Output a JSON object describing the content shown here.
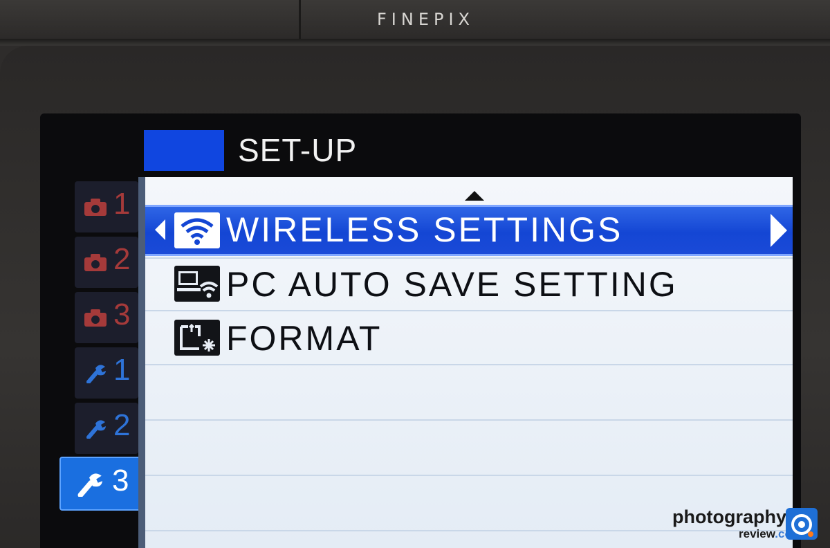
{
  "camera": {
    "brand": "FINEPIX"
  },
  "screen": {
    "title": "SET-UP",
    "title_color": "#1046e0",
    "tabs": [
      {
        "icon": "camera-icon",
        "number": "1",
        "active": false
      },
      {
        "icon": "camera-icon",
        "number": "2",
        "active": false
      },
      {
        "icon": "camera-icon",
        "number": "3",
        "active": false
      },
      {
        "icon": "wrench-icon",
        "number": "1",
        "active": false
      },
      {
        "icon": "wrench-icon",
        "number": "2",
        "active": false
      },
      {
        "icon": "wrench-icon",
        "number": "3",
        "active": true
      }
    ],
    "menu_items": [
      {
        "icon": "wifi-icon",
        "label": "WIRELESS SETTINGS",
        "selected": true
      },
      {
        "icon": "pc-wifi-icon",
        "label": "PC AUTO SAVE SETTING",
        "selected": false
      },
      {
        "icon": "format-icon",
        "label": "FORMAT",
        "selected": false
      }
    ],
    "selection_color": "#1446d4"
  },
  "watermark": {
    "line1": "photography",
    "line2_main": "review",
    "line2_suffix": ".com"
  }
}
